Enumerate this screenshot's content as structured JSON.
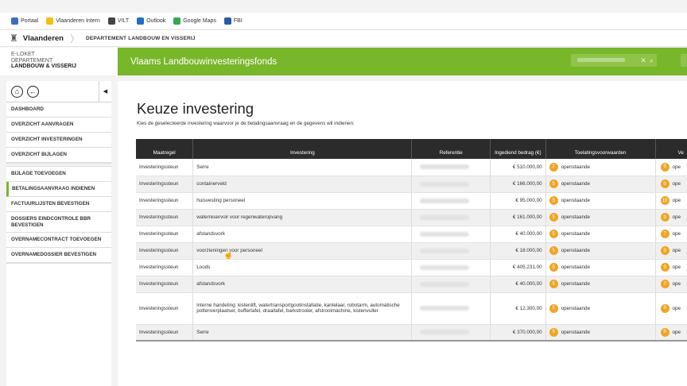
{
  "bookmarks": [
    {
      "label": "Portaal",
      "color": "#3a6fc4"
    },
    {
      "label": "Vlaanderen Intern",
      "color": "#f2c010"
    },
    {
      "label": "VILT",
      "color": "#444444"
    },
    {
      "label": "Outlook",
      "color": "#1f6fc7"
    },
    {
      "label": "Google Maps",
      "color": "#34a853"
    },
    {
      "label": "FBI",
      "color": "#2a5aa8"
    }
  ],
  "header": {
    "brand": "Vlaanderen",
    "department": "DEPARTEMENT LANDBOUW EN VISSERIJ"
  },
  "loket": {
    "line1": "E-LOKET",
    "line2": "DEPARTEMENT",
    "line3": "LANDBOUW & VISSERIJ"
  },
  "banner": {
    "title": "Vlaams Landbouwinvesteringsfonds"
  },
  "sidebar": {
    "items": [
      {
        "label": "DASHBOARD"
      },
      {
        "label": "OVERZICHT AANVRAGEN"
      },
      {
        "label": "OVERZICHT INVESTERINGEN"
      },
      {
        "label": "OVERZICHT BIJLAGEN"
      },
      {
        "label": "BIJLAGE TOEVOEGEN"
      },
      {
        "label": "BETALINGSAANVRAAG INDIENEN"
      },
      {
        "label": "FACTUURLIJSTEN BEVESTIGEN"
      },
      {
        "label": "DOSSIERS EINDCONTROLE BBR BEVESTIGEN"
      },
      {
        "label": "OVERNAMECONTRACT TOEVOEGEN"
      },
      {
        "label": "OVERNAMEDOSSIER BEVESTIGEN"
      }
    ]
  },
  "main": {
    "title": "Keuze investering",
    "subtitle": "Kies de geselecteerde investering waarvoor je de betalingsaanvraag en de gegevens wil indienen:",
    "columns": [
      "Maatregel",
      "Investering",
      "Referentie",
      "Ingediend bedrag (€)",
      "Toelatingsvoorwaarden",
      "Ve"
    ],
    "rows": [
      {
        "maatregel": "Investeringssteun",
        "investering": "Serre",
        "bedrag": "€  510.000,00",
        "badge": "2",
        "status": "openstaande",
        "v_badge": "9",
        "v_text": "ope"
      },
      {
        "maatregel": "Investeringssteun",
        "investering": "containerveld",
        "bedrag": "€  166.000,00",
        "badge": "5",
        "status": "openstaande",
        "v_badge": "9",
        "v_text": "ope"
      },
      {
        "maatregel": "Investeringssteun",
        "investering": "huisvesting personeel",
        "bedrag": "€  95.000,00",
        "badge": "5",
        "status": "openstaande",
        "v_badge": "10",
        "v_text": "ope"
      },
      {
        "maatregel": "Investeringssteun",
        "investering": "waterreservoir voor regenwateropvang",
        "bedrag": "€  161.000,00",
        "badge": "5",
        "status": "openstaande",
        "v_badge": "9",
        "v_text": "ope"
      },
      {
        "maatregel": "Investeringssteun",
        "investering": "afstandsvork",
        "bedrag": "€  40.000,00",
        "badge": "5",
        "status": "openstaande",
        "v_badge": "7",
        "v_text": "ope"
      },
      {
        "maatregel": "Investeringssteun",
        "investering": "voorzieningen voor personeel",
        "bedrag": "€  18.000,00",
        "badge": "5",
        "status": "openstaande",
        "v_badge": "9",
        "v_text": "ope"
      },
      {
        "maatregel": "Investeringssteun",
        "investering": "Loods",
        "bedrag": "€  405.231,00",
        "badge": "5",
        "status": "openstaande",
        "v_badge": "9",
        "v_text": "ope"
      },
      {
        "maatregel": "Investeringssteun",
        "investering": "afstandsvork",
        "bedrag": "€  40.000,00",
        "badge": "5",
        "status": "openstaande",
        "v_badge": "7",
        "v_text": "ope"
      },
      {
        "maatregel": "Investeringssteun",
        "investering": "interne handeling: kistenlift, watertransportgootinstallatie, kantelaar, robotarm, automatische pottenverplaatser, buffertafel, draaitafel, barkstrooier, afstrooimachine, kistenvuller",
        "bedrag": "€  12.300,00",
        "badge": "5",
        "status": "openstaande",
        "v_badge": "9",
        "v_text": "ope"
      },
      {
        "maatregel": "Investeringssteun",
        "investering": "Serre",
        "bedrag": "€  370.000,00",
        "badge": "5",
        "status": "openstaande",
        "v_badge": "9",
        "v_text": "ope"
      }
    ]
  },
  "colors": {
    "accent": "#78b72a",
    "badge": "#f0a526",
    "header_dark": "#2b2b2b"
  }
}
